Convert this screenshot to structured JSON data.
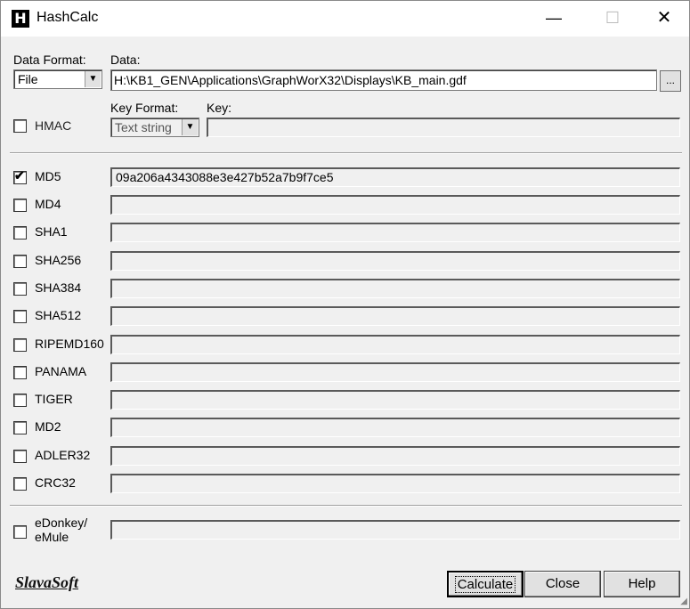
{
  "window": {
    "title": "HashCalc",
    "app_icon": "H"
  },
  "titlebar": {
    "minimize": "—",
    "maximize": "☐",
    "close": "✕"
  },
  "data_format": {
    "label": "Data Format:",
    "value": "File"
  },
  "data": {
    "label": "Data:",
    "value": "H:\\KB1_GEN\\Applications\\GraphWorX32\\Displays\\KB_main.gdf",
    "browse": "..."
  },
  "hmac": {
    "label": "HMAC",
    "checked": false
  },
  "key_format": {
    "label": "Key Format:",
    "value": "Text string"
  },
  "key": {
    "label": "Key:",
    "value": ""
  },
  "algorithms": [
    {
      "name": "MD5",
      "checked": true,
      "value": "09a206a4343088e3e427b52a7b9f7ce5"
    },
    {
      "name": "MD4",
      "checked": false,
      "value": ""
    },
    {
      "name": "SHA1",
      "checked": false,
      "value": ""
    },
    {
      "name": "SHA256",
      "checked": false,
      "value": ""
    },
    {
      "name": "SHA384",
      "checked": false,
      "value": ""
    },
    {
      "name": "SHA512",
      "checked": false,
      "value": ""
    },
    {
      "name": "RIPEMD160",
      "checked": false,
      "value": ""
    },
    {
      "name": "PANAMA",
      "checked": false,
      "value": ""
    },
    {
      "name": "TIGER",
      "checked": false,
      "value": ""
    },
    {
      "name": "MD2",
      "checked": false,
      "value": ""
    },
    {
      "name": "ADLER32",
      "checked": false,
      "value": ""
    },
    {
      "name": "CRC32",
      "checked": false,
      "value": ""
    }
  ],
  "edonkey": {
    "line1": "eDonkey/",
    "line2": "eMule",
    "checked": false,
    "value": ""
  },
  "brand": "SlavaSoft",
  "buttons": {
    "calculate": "Calculate",
    "close": "Close",
    "help": "Help"
  },
  "check_mark": "✔"
}
